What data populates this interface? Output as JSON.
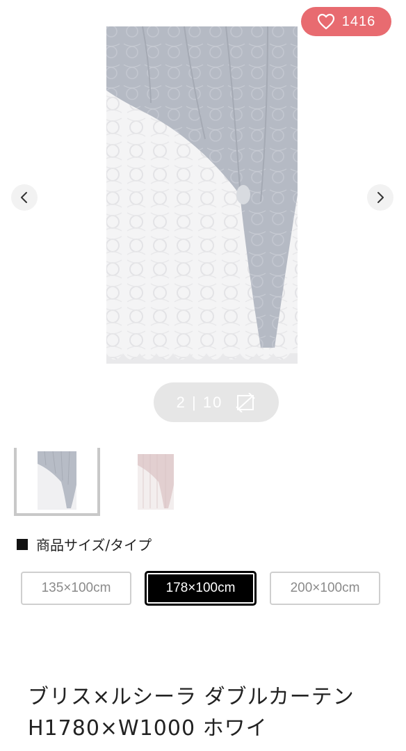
{
  "gallery": {
    "like_count": "1416",
    "counter_text": "2 | 10",
    "thumbnails": [
      {
        "color": "light-gray",
        "selected": true
      },
      {
        "color": "pink",
        "selected": false
      }
    ]
  },
  "size_section": {
    "heading": "商品サイズ/タイプ",
    "options": [
      {
        "label": "135×100cm",
        "selected": false
      },
      {
        "label": "178×100cm",
        "selected": true
      },
      {
        "label": "200×100cm",
        "selected": false
      }
    ]
  },
  "product": {
    "title": "ブリス×ルシーラ ダブルカーテン H1780×W1000 ホワイ"
  },
  "colors": {
    "like_badge": "#e86b70",
    "selected_size_bg": "#000000",
    "counter_pill_bg": "#e6e6e6"
  },
  "icons": {
    "like": "heart-outline-icon",
    "prev": "chevron-left-icon",
    "next": "chevron-right-icon",
    "expand": "expand-icon"
  }
}
